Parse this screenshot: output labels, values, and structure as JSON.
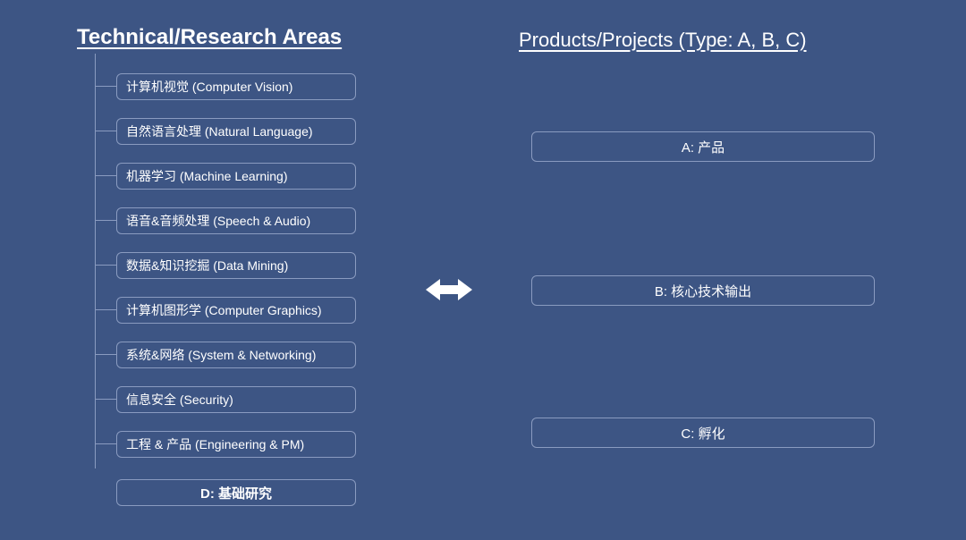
{
  "left_header": "Technical/Research Areas",
  "right_header": "Products/Projects (Type: A, B, C)",
  "tree_items": [
    "计算机视觉 (Computer Vision)",
    "自然语言处理 (Natural Language)",
    "机器学习 (Machine Learning)",
    "语音&音频处理 (Speech & Audio)",
    "数据&知识挖掘 (Data Mining)",
    "计算机图形学 (Computer Graphics)",
    "系统&网络 (System & Networking)",
    "信息安全 (Security)",
    "工程 & 产品 (Engineering & PM)"
  ],
  "d_box": "D: 基础研究",
  "right_boxes": {
    "a": "A: 产品",
    "b": "B: 核心技术输出",
    "c": "C: 孵化"
  }
}
